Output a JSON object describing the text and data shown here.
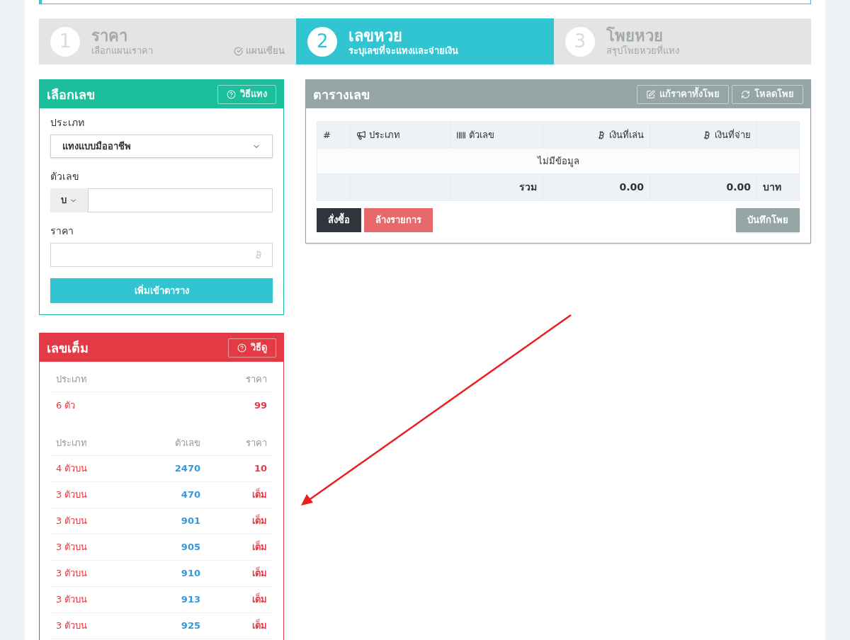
{
  "steps": [
    {
      "number": "1",
      "title": "ราคา",
      "subtitle": "เลือกแผนเราคา",
      "note": "แผนเซียน",
      "selected": false
    },
    {
      "number": "2",
      "title": "เลขหวย",
      "subtitle": "ระบุเลขที่จะแทงและจ่ายเงิน",
      "selected": true
    },
    {
      "number": "3",
      "title": "โพยหวย",
      "subtitle": "สรุปโพยหวยที่แทง",
      "selected": false
    }
  ],
  "pick_panel": {
    "title": "เลือกเลข",
    "help_button": "วิธีแทง",
    "type_label": "ประเภท",
    "type_value": "แทงแบบมืออาชีพ",
    "number_label": "ตัวเลข",
    "number_prefix": "บ",
    "price_label": "ราคา",
    "add_button": "เพิ่มเข้าตาราง"
  },
  "full_panel": {
    "title": "เลขเต็ม",
    "help_button": "วิธีดู",
    "set_columns": [
      "ประเภท",
      "ราคา"
    ],
    "set_rows": [
      {
        "type": "6 ตัว",
        "price": "99"
      }
    ],
    "number_columns": [
      "ประเภท",
      "ตัวเลข",
      "ราคา"
    ],
    "number_rows": [
      {
        "type": "4 ตัวบน",
        "number": "2470",
        "price": "10"
      },
      {
        "type": "3 ตัวบน",
        "number": "470",
        "price": "เต็ม"
      },
      {
        "type": "3 ตัวบน",
        "number": "901",
        "price": "เต็ม"
      },
      {
        "type": "3 ตัวบน",
        "number": "905",
        "price": "เต็ม"
      },
      {
        "type": "3 ตัวบน",
        "number": "910",
        "price": "เต็ม"
      },
      {
        "type": "3 ตัวบน",
        "number": "913",
        "price": "เต็ม"
      },
      {
        "type": "3 ตัวบน",
        "number": "925",
        "price": "เต็ม"
      }
    ]
  },
  "table_panel": {
    "title": "ตารางเลข",
    "edit_button": "แก้ราคาทั้งโพย",
    "load_button": "โหลดโพย",
    "columns": [
      "#",
      "ประเภท",
      "ตัวเลข",
      "เงินที่เล่น",
      "เงินที่จ่าย"
    ],
    "empty_text": "ไม่มีข้อมูล",
    "total_label": "รวม",
    "total_bet": "0.00",
    "total_pay": "0.00",
    "currency": "บาท",
    "order_button": "สั่งซื้อ",
    "clear_button": "ล้างรายการ",
    "save_button": "บันทึกโพย"
  }
}
